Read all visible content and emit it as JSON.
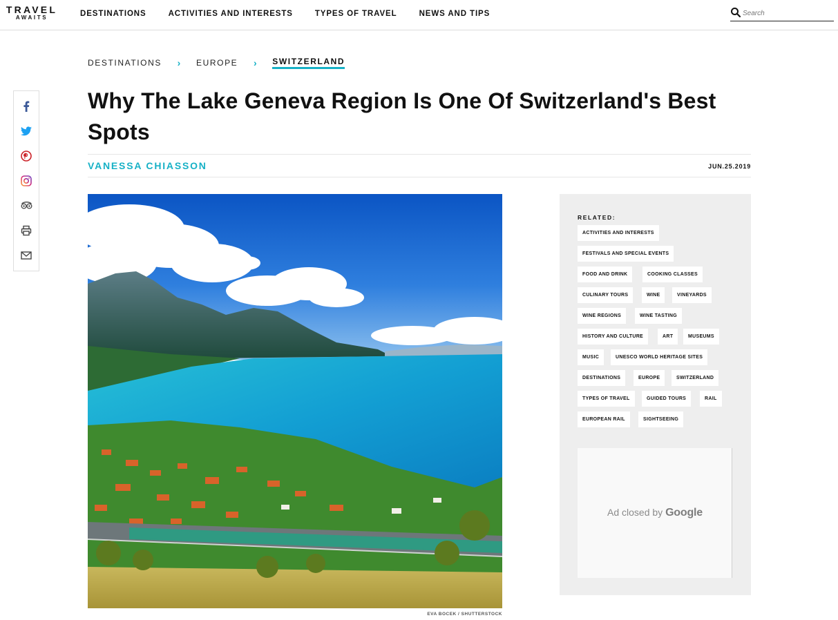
{
  "brand": {
    "top": "TRAVEL",
    "bottom": "AWAITS"
  },
  "nav": {
    "items": [
      "DESTINATIONS",
      "ACTIVITIES AND INTERESTS",
      "TYPES OF TRAVEL",
      "NEWS AND TIPS"
    ]
  },
  "search": {
    "placeholder": "Search"
  },
  "breadcrumb": {
    "items": [
      "DESTINATIONS",
      "EUROPE",
      "SWITZERLAND"
    ],
    "separator": "›"
  },
  "article": {
    "title": "Why The Lake Geneva Region Is One Of Switzerland's Best Spots",
    "author": "VANESSA CHIASSON",
    "date": "JUN.25.2019",
    "image_credit": "EVA BOCEK / SHUTTERSTOCK"
  },
  "social": [
    "facebook-icon",
    "twitter-icon",
    "pinterest-icon",
    "instagram-icon",
    "tripadvisor-icon",
    "print-icon",
    "email-icon"
  ],
  "related": {
    "label": "RELATED:",
    "tags": [
      "ACTIVITIES AND INTERESTS",
      "FESTIVALS AND SPECIAL EVENTS",
      "FOOD AND DRINK",
      "COOKING CLASSES",
      "CULINARY TOURS",
      "WINE",
      "VINEYARDS",
      "WINE REGIONS",
      "WINE TASTING",
      "HISTORY AND CULTURE",
      "ART",
      "MUSEUMS",
      "MUSIC",
      "UNESCO WORLD HERITAGE SITES",
      "DESTINATIONS",
      "EUROPE",
      "SWITZERLAND",
      "TYPES OF TRAVEL",
      "GUIDED TOURS",
      "RAIL",
      "EUROPEAN RAIL",
      "SIGHTSEEING"
    ]
  },
  "ad": {
    "prefix": "Ad closed by ",
    "brand": "Google"
  },
  "colors": {
    "accent": "#17b1c6",
    "facebook": "#3b5998",
    "twitter": "#1da1f2",
    "pinterest": "#cb2027",
    "instagram": "#c13584"
  }
}
